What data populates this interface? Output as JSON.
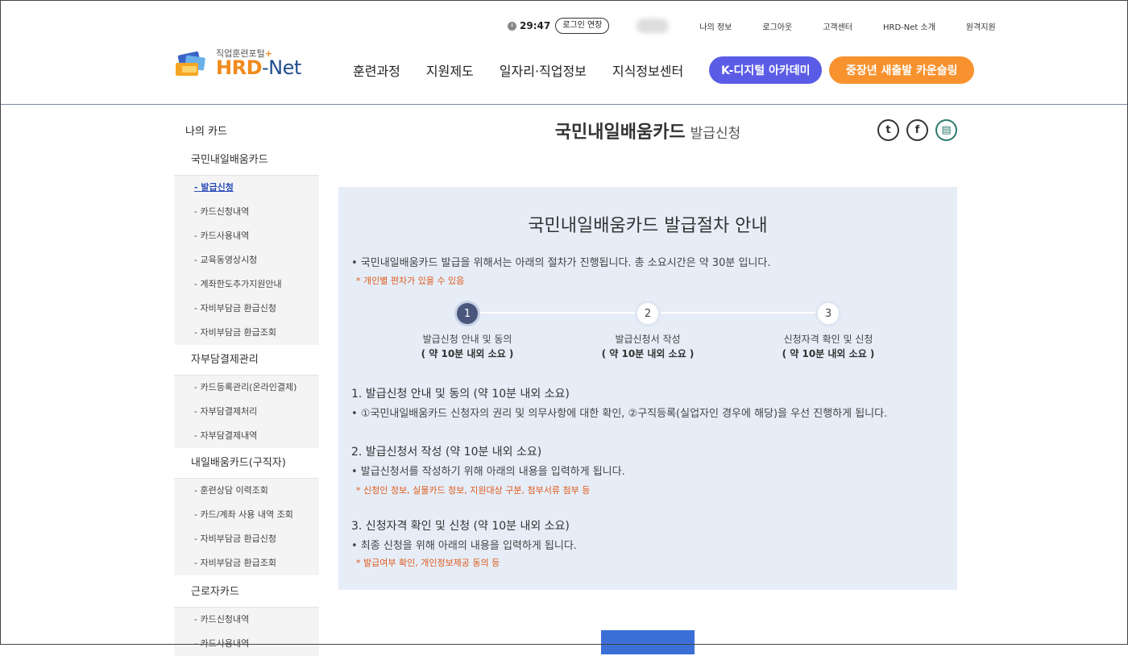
{
  "header": {
    "timer": "29:47",
    "extend_label": "로그인 연장",
    "util_links": [
      "나의 정보",
      "로그아웃",
      "고객센터",
      "HRD-Net 소개",
      "원격지원"
    ],
    "logo_sub": "직업훈련포털",
    "logo_plus": "+",
    "logo_hrd": "HRD",
    "logo_dash": "-",
    "logo_net": "Net",
    "nav": [
      "훈련과정",
      "지원제도",
      "일자리·직업정보",
      "지식정보센터"
    ],
    "pill_k": "K-디지털 아카데미",
    "pill_c": "중장년 새출발 카운슬링"
  },
  "sidebar": {
    "title": "나의 카드",
    "groups": [
      {
        "label": "국민내일배움카드",
        "items": [
          "- 발급신청",
          "- 카드신청내역",
          "- 카드사용내역",
          "- 교육동영상시청",
          "- 계좌한도추가지원안내",
          "- 자비부담금 환급신청",
          "- 자비부담금 환급조회"
        ]
      },
      {
        "label": "자부담결제관리",
        "items": [
          "- 카드등록관리(온라인결제)",
          "- 자부담결제처리",
          "- 자부담결제내역"
        ]
      },
      {
        "label": "내일배움카드(구직자)",
        "items": [
          "- 훈련상담 이력조회",
          "- 카드/계좌 사용 내역 조회",
          "- 자비부담금 환급신청",
          "- 자비부담금 환급조회"
        ]
      },
      {
        "label": "근로자카드",
        "items": [
          "- 카드신청내역",
          "- 카드사용내역"
        ]
      }
    ]
  },
  "page": {
    "title": "국민내일배움카드",
    "subtitle": "발급신청"
  },
  "share": {
    "twitter": "t",
    "facebook": "f",
    "print": "▤"
  },
  "guide": {
    "title": "국민내일배움카드 발급절차 안내",
    "intro": "• 국민내일배움카드 발급을 위해서는 아래의 절차가 진행됩니다. 총 소요시간은 약 30분 입니다.",
    "note": "* 개인별 편차가 있을 수 있음",
    "steps": [
      {
        "num": "1",
        "label": "발급신청 안내 및 동의",
        "time": "( 약 10분 내외 소요 )"
      },
      {
        "num": "2",
        "label": "발급신청서 작성",
        "time": "( 약 10분 내외 소요 )"
      },
      {
        "num": "3",
        "label": "신청자격 확인 및 신청",
        "time": "( 약 10분 내외 소요 )"
      }
    ],
    "sections": [
      {
        "title": "1. 발급신청 안내 및 동의 (약 10분 내외 소요)",
        "desc": "• ①국민내일배움카드 신청자의 권리 및 의무사항에 대한 확인, ②구직등록(실업자인 경우에 해당)을 우선 진행하게 됩니다.",
        "note": ""
      },
      {
        "title": "2. 발급신청서 작성 (약 10분 내외 소요)",
        "desc": "• 발급신청서를 작성하기 위해 아래의 내용을 입력하게 됩니다.",
        "note": "* 신청인 정보, 실물카드 정보, 지원대상 구분, 첨부서류 첨부 등"
      },
      {
        "title": "3. 신청자격 확인 및 신청 (약 10분 내외 소요)",
        "desc": "• 최종 신청을 위해 아래의 내용을 입력하게 됩니다.",
        "note": "* 발급여부 확인, 개인정보제공 동의 등"
      }
    ]
  }
}
